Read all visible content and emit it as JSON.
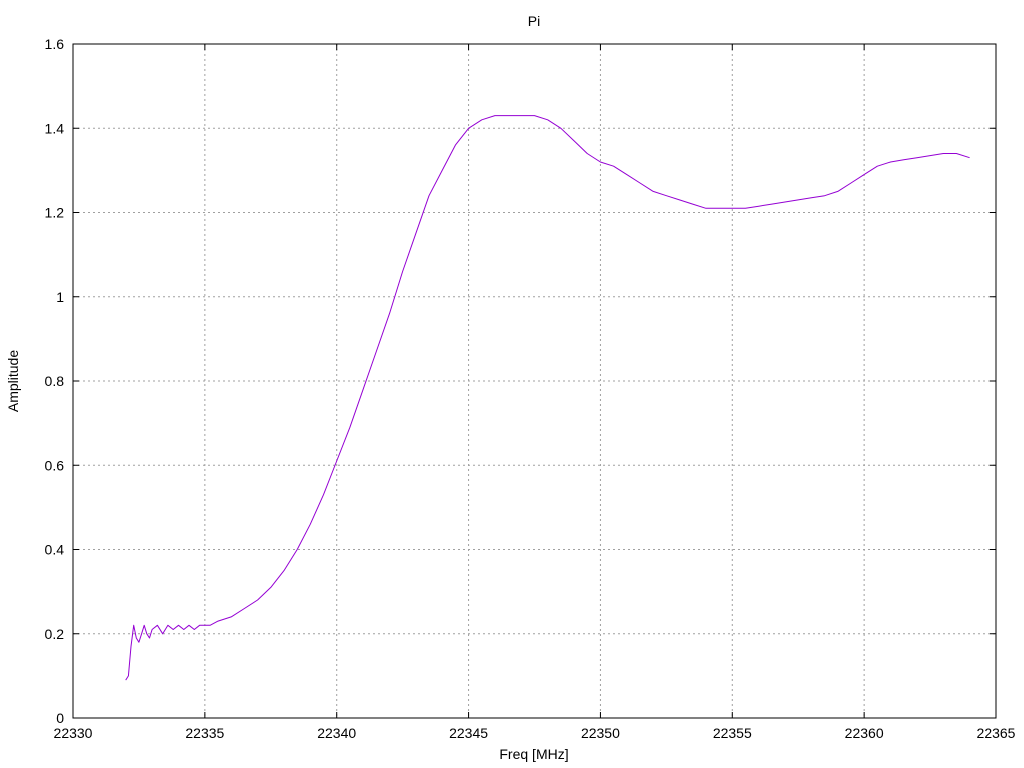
{
  "chart_data": {
    "type": "line",
    "title": "Pi",
    "xlabel": "Freq [MHz]",
    "ylabel": "Amplitude",
    "xlim": [
      22330,
      22365
    ],
    "ylim": [
      0,
      1.6
    ],
    "grid": true,
    "x_ticks": [
      22330,
      22335,
      22340,
      22345,
      22350,
      22355,
      22360,
      22365
    ],
    "x_tick_labels": [
      "22330",
      "22335",
      "22340",
      "22345",
      "22350",
      "22355",
      "22360",
      "22365"
    ],
    "y_ticks": [
      0,
      0.2,
      0.4,
      0.6,
      0.8,
      1.0,
      1.2,
      1.4,
      1.6
    ],
    "y_tick_labels": [
      "0",
      "0.2",
      "0.4",
      "0.6",
      "0.8",
      "1",
      "1.2",
      "1.4",
      "1.6"
    ],
    "series": [
      {
        "color": "#9400d3",
        "x": [
          22332.0,
          22332.1,
          22332.2,
          22332.3,
          22332.4,
          22332.5,
          22332.6,
          22332.7,
          22332.8,
          22332.9,
          22333.0,
          22333.2,
          22333.4,
          22333.6,
          22333.8,
          22334.0,
          22334.2,
          22334.4,
          22334.6,
          22334.8,
          22335.0,
          22335.2,
          22335.5,
          22336.0,
          22336.5,
          22337.0,
          22337.5,
          22338.0,
          22338.5,
          22339.0,
          22339.5,
          22340.0,
          22340.5,
          22341.0,
          22341.5,
          22342.0,
          22342.5,
          22343.0,
          22343.5,
          22344.0,
          22344.5,
          22345.0,
          22345.5,
          22346.0,
          22346.5,
          22347.0,
          22347.5,
          22348.0,
          22348.5,
          22349.0,
          22349.5,
          22350.0,
          22350.5,
          22351.0,
          22351.5,
          22352.0,
          22352.5,
          22353.0,
          22353.5,
          22354.0,
          22354.5,
          22355.0,
          22355.5,
          22356.0,
          22356.5,
          22357.0,
          22357.5,
          22358.0,
          22358.5,
          22359.0,
          22359.5,
          22360.0,
          22360.5,
          22361.0,
          22361.5,
          22362.0,
          22362.5,
          22363.0,
          22363.5,
          22364.0
        ],
        "y": [
          0.09,
          0.1,
          0.17,
          0.22,
          0.19,
          0.18,
          0.2,
          0.22,
          0.2,
          0.19,
          0.21,
          0.22,
          0.2,
          0.22,
          0.21,
          0.22,
          0.21,
          0.22,
          0.21,
          0.22,
          0.22,
          0.22,
          0.23,
          0.24,
          0.26,
          0.28,
          0.31,
          0.35,
          0.4,
          0.46,
          0.53,
          0.61,
          0.69,
          0.78,
          0.87,
          0.96,
          1.06,
          1.15,
          1.24,
          1.3,
          1.36,
          1.4,
          1.42,
          1.43,
          1.43,
          1.43,
          1.43,
          1.42,
          1.4,
          1.37,
          1.34,
          1.32,
          1.31,
          1.29,
          1.27,
          1.25,
          1.24,
          1.23,
          1.22,
          1.21,
          1.21,
          1.21,
          1.21,
          1.215,
          1.22,
          1.225,
          1.23,
          1.235,
          1.24,
          1.25,
          1.27,
          1.29,
          1.31,
          1.32,
          1.325,
          1.33,
          1.335,
          1.34,
          1.34,
          1.33
        ]
      }
    ]
  }
}
